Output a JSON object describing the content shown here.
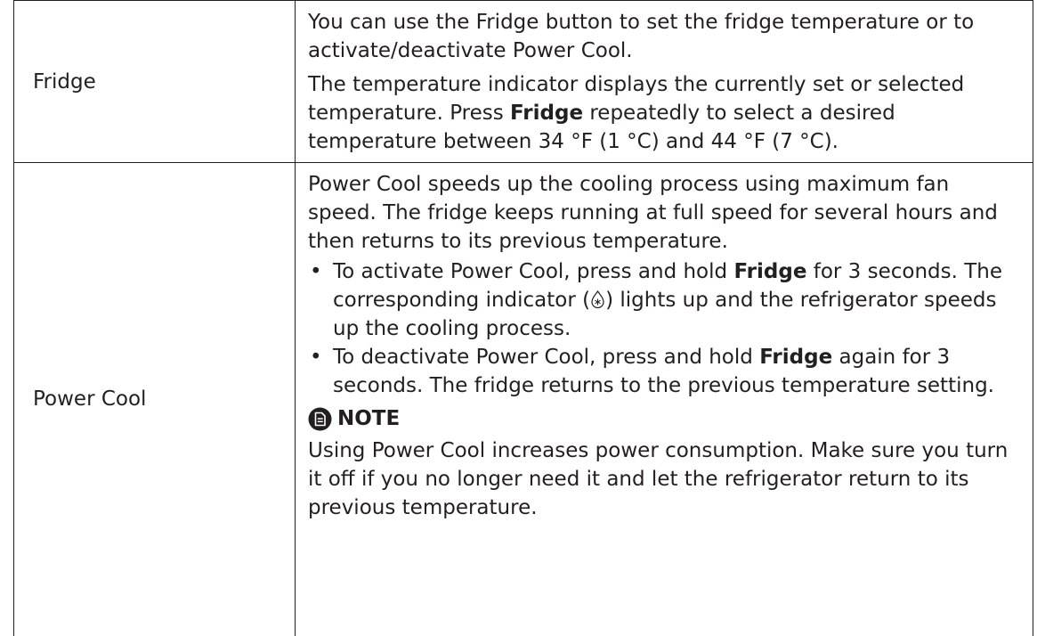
{
  "rows": [
    {
      "label": "Fridge",
      "paragraph1": "You can use the Fridge button to set the fridge temperature or to activate/deactivate Power Cool.",
      "paragraph2_pre": "The temperature indicator displays the currently set or selected temperature. Press ",
      "paragraph2_bold": "Fridge",
      "paragraph2_post": " repeatedly to select a desired temperature between 34 °F (1 °C) and 44 °F (7 °C)."
    },
    {
      "label": "Power Cool",
      "intro": "Power Cool speeds up the cooling process using maximum fan speed. The fridge keeps running at full speed for several hours and then returns to its previous temperature.",
      "bullets": [
        {
          "pre": "To activate Power Cool, press and hold ",
          "bold": "Fridge",
          "mid": " for 3 seconds. The corresponding indicator (",
          "icon": "power-cool-indicator-icon",
          "post": ") lights up and the refrigerator speeds up the cooling process."
        },
        {
          "pre": "To deactivate Power Cool, press and hold ",
          "bold": "Fridge",
          "post": " again for 3 seconds. The fridge returns to the previous temperature setting."
        }
      ],
      "note": {
        "icon": "note-icon",
        "label": "NOTE",
        "text": "Using Power Cool increases power consumption. Make sure you turn it off if you no longer need it and let the refrigerator return to its previous temperature."
      }
    }
  ]
}
